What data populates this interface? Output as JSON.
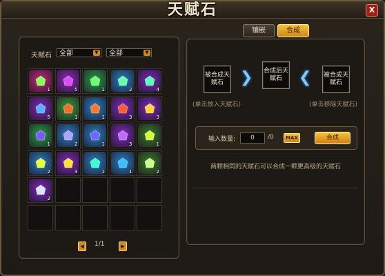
{
  "window": {
    "title": "天赋石",
    "close_label": "X"
  },
  "tabs": [
    {
      "label": "镶嵌",
      "active": false
    },
    {
      "label": "合成",
      "active": true
    }
  ],
  "filters": {
    "label": "天赋石",
    "select1": "全部",
    "select2": "全部"
  },
  "inventory": [
    {
      "color": "#c02a7a",
      "gem": "#8cff5a",
      "qty": "1"
    },
    {
      "color": "#8b2ab8",
      "gem": "#e24bff",
      "qty": "5"
    },
    {
      "color": "#2a9a4a",
      "gem": "#6dff6d",
      "qty": "1"
    },
    {
      "color": "#2a7ec0",
      "gem": "#66ffb0",
      "qty": "2"
    },
    {
      "color": "#7a2ab8",
      "gem": "#5affc0",
      "qty": "4"
    },
    {
      "color": "#7a2ab8",
      "gem": "#5ab0ff",
      "qty": "5"
    },
    {
      "color": "#3a9a3a",
      "gem": "#ff6a2a",
      "qty": "1"
    },
    {
      "color": "#2a7ec0",
      "gem": "#ff7a2a",
      "qty": "1"
    },
    {
      "color": "#7a2ab8",
      "gem": "#ff5a3a",
      "qty": "3"
    },
    {
      "color": "#7a2ab8",
      "gem": "#ffd23a",
      "qty": "3"
    },
    {
      "color": "#2a9a4a",
      "gem": "#7a5aff",
      "qty": "1"
    },
    {
      "color": "#2a7ec0",
      "gem": "#b0a0ff",
      "qty": "2"
    },
    {
      "color": "#2a7ec0",
      "gem": "#6a6aff",
      "qty": "1"
    },
    {
      "color": "#7a2ab8",
      "gem": "#c06aff",
      "qty": "3"
    },
    {
      "color": "#3a7a2a",
      "gem": "#d0ff3a",
      "qty": "1"
    },
    {
      "color": "#2a7ec0",
      "gem": "#e6ff3a",
      "qty": "2"
    },
    {
      "color": "#7a2ab8",
      "gem": "#ffe03a",
      "qty": "3"
    },
    {
      "color": "#2a7ec0",
      "gem": "#3affd0",
      "qty": "1"
    },
    {
      "color": "#2a7ec0",
      "gem": "#3ac0ff",
      "qty": "1"
    },
    {
      "color": "#3a7a2a",
      "gem": "#ccff88",
      "qty": "2"
    },
    {
      "color": "#7a2ab8",
      "gem": "#e0e0ff",
      "qty": "2"
    }
  ],
  "pager": {
    "text": "1/1",
    "prev": "◀",
    "next": "▶"
  },
  "synthesis": {
    "slot_left": "被合成天赋石",
    "slot_result": "合成后天赋石",
    "slot_right": "被合成天赋石",
    "hint_left": "(单击放入天赋石)",
    "hint_right": "(单击移除天赋石)",
    "qty_label": "输入数量:",
    "qty_value": "0",
    "qty_max_text": "/0",
    "max_button": "MAX",
    "combine_button": "合成",
    "description": "两颗相同的天赋石可以合成一颗更高级的天赋石"
  }
}
